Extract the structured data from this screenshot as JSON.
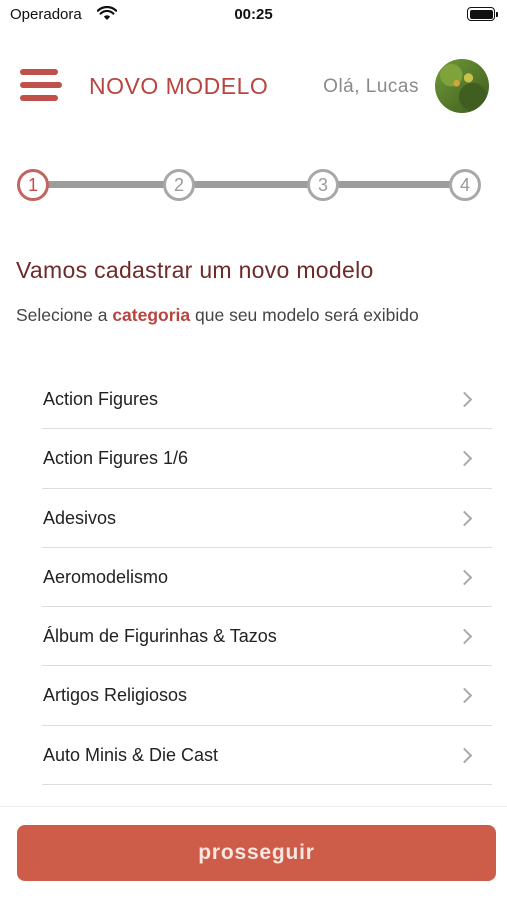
{
  "status_bar": {
    "carrier": "Operadora",
    "time": "00:25",
    "wifi_icon": "wifi-icon",
    "battery_icon": "battery-icon"
  },
  "header": {
    "menu_icon": "hamburger-menu-icon",
    "title": "NOVO MODELO",
    "greeting": "Olá, Lucas"
  },
  "stepper": {
    "steps": [
      "1",
      "2",
      "3",
      "4"
    ],
    "current_step": 1
  },
  "intro": {
    "title": "Vamos cadastrar um novo modelo",
    "text_before": "Selecione a ",
    "highlight": "categoria",
    "text_after": " que seu modelo será exibido"
  },
  "categories": [
    "Action Figures",
    "Action Figures 1/6",
    "Adesivos",
    "Aeromodelismo",
    "Álbum de Figurinhas & Tazos",
    "Artigos Religiosos",
    "Auto Minis & Die Cast"
  ],
  "footer": {
    "proceed_label": "prosseguir"
  },
  "colors": {
    "accent": "#b8453f",
    "button": "#cd5d48",
    "title_dark": "#6e2a2a",
    "step_inactive": "#a8a8a8"
  }
}
